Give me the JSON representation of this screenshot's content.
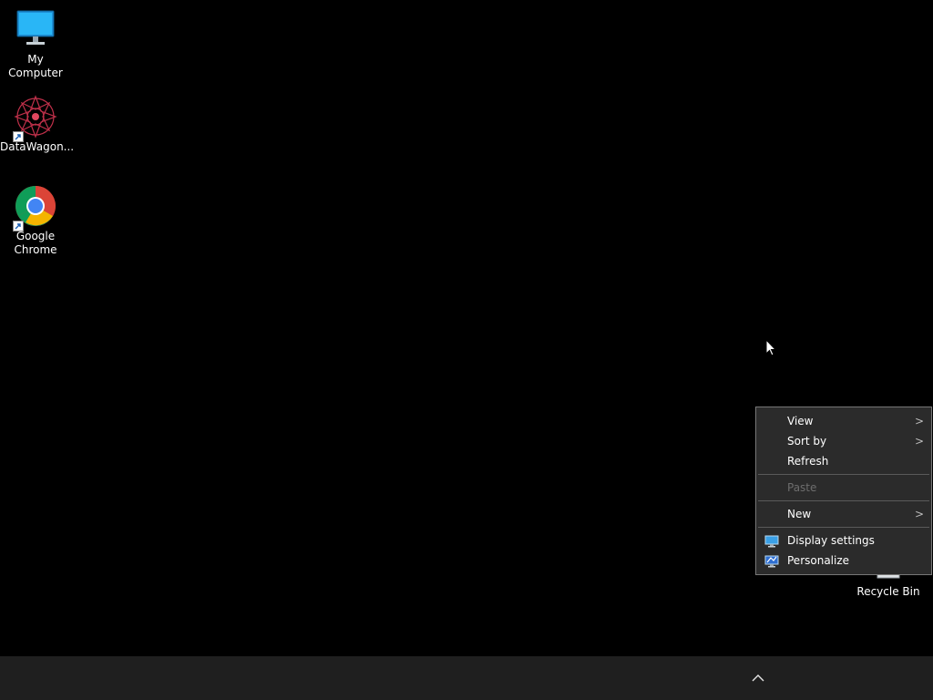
{
  "desktop": {
    "icons": [
      {
        "label": "My Computer",
        "icon": "monitor-icon"
      },
      {
        "label": "DataWagon...",
        "icon": "datawagon-mandala-icon"
      },
      {
        "label": "Google\nChrome",
        "icon": "chrome-icon"
      },
      {
        "label": "Recycle Bin",
        "icon": "recycle-bin-icon"
      }
    ]
  },
  "context_menu": {
    "items": [
      {
        "label": "View",
        "submenu": true
      },
      {
        "label": "Sort by",
        "submenu": true
      },
      {
        "label": "Refresh"
      },
      {
        "label": "Paste",
        "disabled": true
      },
      {
        "label": "New",
        "submenu": true
      },
      {
        "label": "Display settings",
        "icon": "display-settings-icon"
      },
      {
        "label": "Personalize",
        "icon": "personalize-icon"
      }
    ],
    "submenu_glyph": ">"
  },
  "taskbar": {
    "tray_icon": "chevron-up-icon"
  },
  "colors": {
    "desktop_bg": "#000000",
    "menu_bg": "#2b2b2b",
    "menu_border": "#777777",
    "disabled_text": "#6d6d6d",
    "taskbar_bg": "#1f1f1f"
  }
}
